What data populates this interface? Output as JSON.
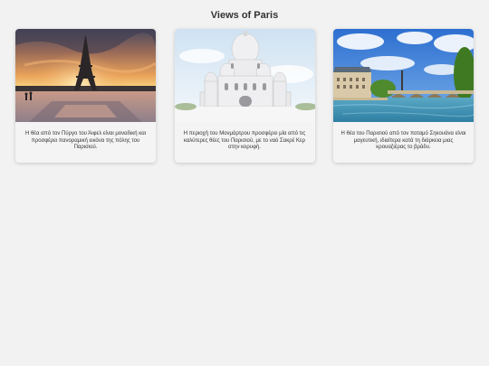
{
  "page": {
    "title": "Views of Paris"
  },
  "cards": [
    {
      "image_alt": "Eiffel Tower at sunset",
      "caption": "Η θέα από τον Πύργο του Άιφελ είναι μοναδική και προσφέρει πανοραμική εικόνα της πόλης του Παρισιού."
    },
    {
      "image_alt": "Sacré-Cœur basilica",
      "caption": "Η περιοχή του Μονμάρτρου προσφέρει μία από τις καλύτερες θέες του Παρισιού, με το ναό Σακρέ Κερ στην κορυφή."
    },
    {
      "image_alt": "Seine river with bridge",
      "caption": "Η θέα του Παρισιού από τον ποταμό Σηκουάνα είναι μαγευτική, ιδιαίτερα κατά τη διάρκεια μιας κρουαζιέρας το βράδυ."
    }
  ],
  "colors": {
    "background": "#f2f2f2",
    "card": "#f4f4f4",
    "text": "#333333"
  }
}
